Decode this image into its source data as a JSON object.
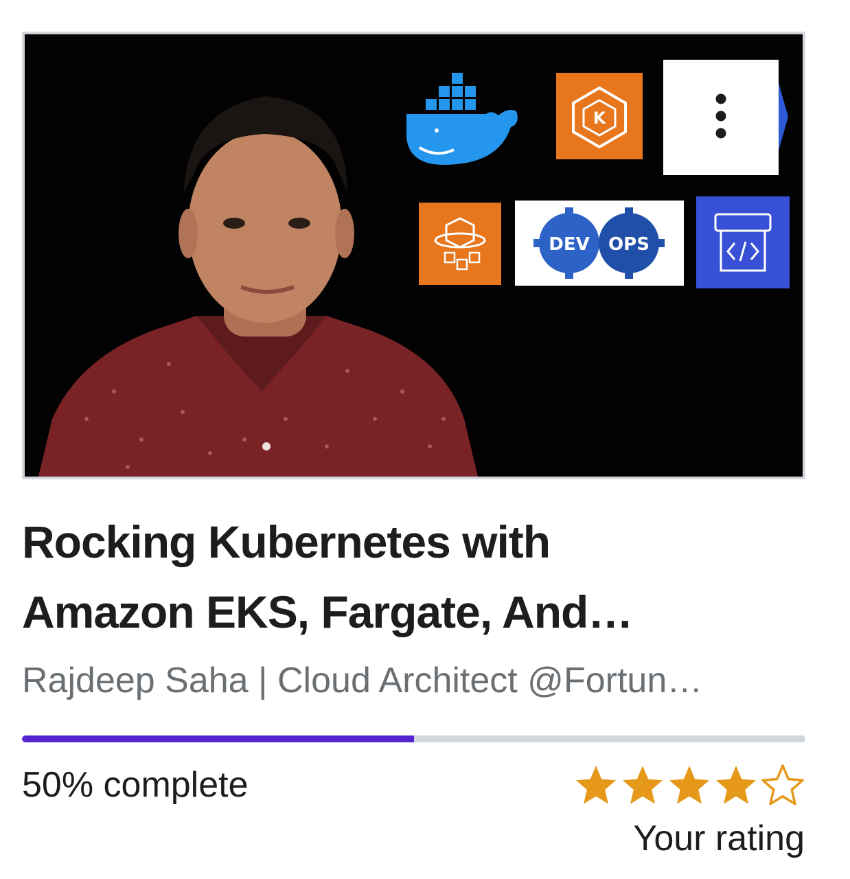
{
  "course": {
    "title_line1": "Rocking Kubernetes with",
    "title_line2": "Amazon EKS, Fargate, And…",
    "instructor": "Rajdeep Saha | Cloud Architect @Fortun…",
    "thumbnail": {
      "logo_dev_text": "DEV",
      "logo_ops_text": "OPS",
      "logo_k_text": "K"
    }
  },
  "progress": {
    "percent": 50,
    "label": "50% complete",
    "color": "#5624d0",
    "track_color": "#d1d7dc"
  },
  "rating": {
    "value": 4,
    "max": 5,
    "label": "Your rating",
    "color": "#e59819"
  },
  "menu": {
    "icon": "more-vertical-icon"
  }
}
